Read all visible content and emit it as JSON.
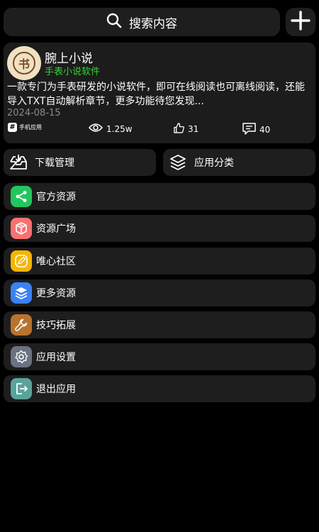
{
  "search": {
    "label": "搜索内容"
  },
  "featured": {
    "icon_char": "书",
    "name": "腕上小说",
    "subtitle": "手表小说软件",
    "description": "一款专门为手表研发的小说软件，即可在线阅读也可离线阅读，还能导入TXT自动解析章节，更多功能待您发现...",
    "date": "2024-08-15",
    "tag": "手机应用",
    "views": "1.25w",
    "likes": "31",
    "comments": "40"
  },
  "quick_actions": [
    {
      "label": "下载管理",
      "icon": "download-tray-icon"
    },
    {
      "label": "应用分类",
      "icon": "layers-icon"
    }
  ],
  "menu": [
    {
      "label": "官方资源",
      "icon": "share-icon",
      "color": "#22c55e"
    },
    {
      "label": "资源广场",
      "icon": "box-icon",
      "color": "#f87171"
    },
    {
      "label": "唯心社区",
      "icon": "note-icon",
      "color": "#f7b500"
    },
    {
      "label": "更多资源",
      "icon": "stack-icon",
      "color": "#3b82f6"
    },
    {
      "label": "技巧拓展",
      "icon": "wrench-icon",
      "color": "#b7732f"
    },
    {
      "label": "应用设置",
      "icon": "gear-icon",
      "color": "#6b7280"
    },
    {
      "label": "退出应用",
      "icon": "exit-icon",
      "color": "#5aa39a"
    }
  ]
}
